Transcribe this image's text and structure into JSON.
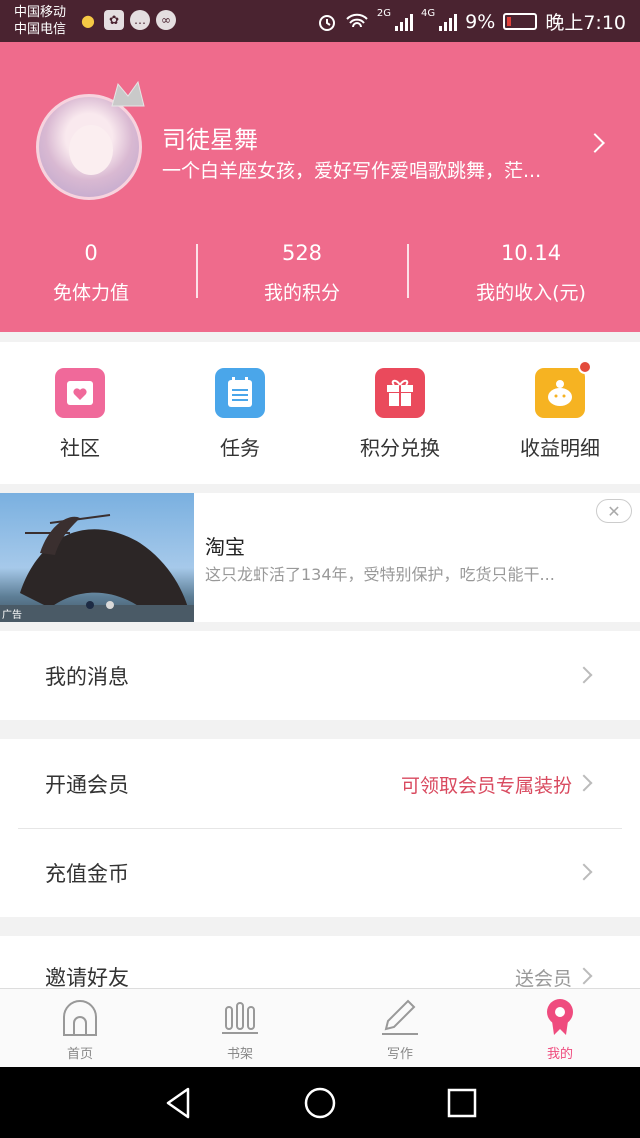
{
  "status_bar": {
    "carrier_1": "中国移动",
    "carrier_2": "中国电信",
    "net_label": "2G",
    "net_label_2": "4G",
    "battery_percent": "9%",
    "time": "晚上7:10"
  },
  "profile": {
    "nickname": "司徒星舞",
    "bio": "一个白羊座女孩，爱好写作爱唱歌跳舞，茫...",
    "stats": [
      {
        "value": "0",
        "label": "免体力值"
      },
      {
        "value": "528",
        "label": "我的积分"
      },
      {
        "value": "10.14",
        "label": "我的收入(元)"
      }
    ]
  },
  "actions": [
    {
      "label": "社区",
      "icon": "community-icon",
      "color": "#f0699a"
    },
    {
      "label": "任务",
      "icon": "task-icon",
      "color": "#4aa6ea"
    },
    {
      "label": "积分兑换",
      "icon": "gift-icon",
      "color": "#ea4a5c"
    },
    {
      "label": "收益明细",
      "icon": "piggy-bank-icon",
      "color": "#f6b322",
      "badge": true
    }
  ],
  "ad": {
    "title": "淘宝",
    "desc": "这只龙虾活了134年，受特别保护，吃货只能干...",
    "tag": "广告",
    "close": "✕"
  },
  "menu": {
    "messages": {
      "label": "我的消息"
    },
    "vip": {
      "label": "开通会员",
      "value": "可领取会员专属装扮",
      "value_color": "#d94a5f"
    },
    "recharge": {
      "label": "充值金币"
    },
    "invite": {
      "label": "邀请好友",
      "value": "送会员",
      "value_color": "#999999"
    }
  },
  "bottom_nav": [
    {
      "label": "首页",
      "icon": "home-icon"
    },
    {
      "label": "书架",
      "icon": "bookshelf-icon"
    },
    {
      "label": "写作",
      "icon": "pen-icon"
    },
    {
      "label": "我的",
      "icon": "profile-icon",
      "active": true
    }
  ],
  "theme": {
    "accent": "#ef6b8c",
    "active_tab": "#ef4b7e"
  }
}
